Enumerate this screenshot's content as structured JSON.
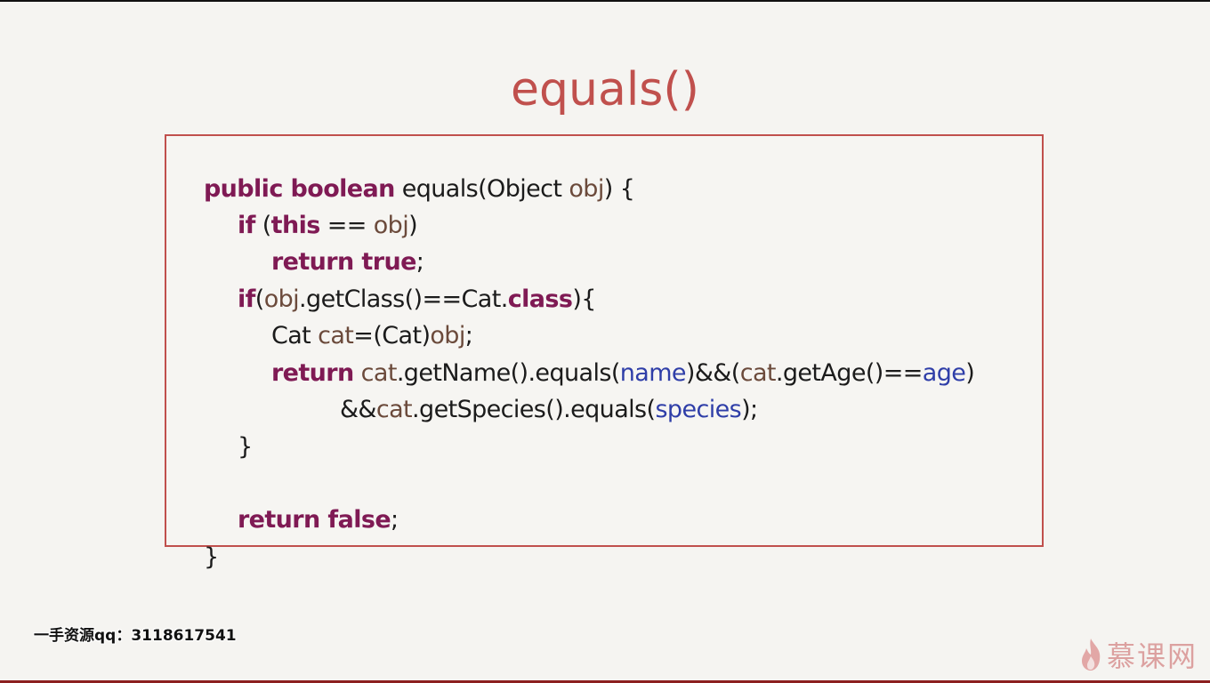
{
  "slide": {
    "title": "equals()"
  },
  "code": {
    "lines": [
      [
        {
          "t": "public boolean",
          "c": "kw"
        },
        {
          "t": " equals(Object ",
          "c": "n"
        },
        {
          "t": "obj",
          "c": "var"
        },
        {
          "t": ") {",
          "c": "n"
        }
      ],
      [
        {
          "t": "if",
          "c": "kw"
        },
        {
          "t": " (",
          "c": "n"
        },
        {
          "t": "this",
          "c": "kw"
        },
        {
          "t": " == ",
          "c": "n"
        },
        {
          "t": "obj",
          "c": "var"
        },
        {
          "t": ")",
          "c": "n"
        }
      ],
      [
        {
          "t": "return true",
          "c": "kw"
        },
        {
          "t": ";",
          "c": "n"
        }
      ],
      [
        {
          "t": "if",
          "c": "kw"
        },
        {
          "t": "(",
          "c": "n"
        },
        {
          "t": "obj",
          "c": "var"
        },
        {
          "t": ".getClass()==Cat.",
          "c": "n"
        },
        {
          "t": "class",
          "c": "kw"
        },
        {
          "t": "){",
          "c": "n"
        }
      ],
      [
        {
          "t": "Cat ",
          "c": "n"
        },
        {
          "t": "cat",
          "c": "var"
        },
        {
          "t": "=(Cat)",
          "c": "n"
        },
        {
          "t": "obj",
          "c": "var"
        },
        {
          "t": ";",
          "c": "n"
        }
      ],
      [
        {
          "t": "return",
          "c": "kw"
        },
        {
          "t": " ",
          "c": "n"
        },
        {
          "t": "cat",
          "c": "var"
        },
        {
          "t": ".getName().equals(",
          "c": "n"
        },
        {
          "t": "name",
          "c": "fld"
        },
        {
          "t": ")&&(",
          "c": "n"
        },
        {
          "t": "cat",
          "c": "var"
        },
        {
          "t": ".getAge()==",
          "c": "n"
        },
        {
          "t": "age",
          "c": "fld"
        },
        {
          "t": ")",
          "c": "n"
        }
      ],
      [
        {
          "t": "&&",
          "c": "n"
        },
        {
          "t": "cat",
          "c": "var"
        },
        {
          "t": ".getSpecies().equals(",
          "c": "n"
        },
        {
          "t": "species",
          "c": "fld"
        },
        {
          "t": ");",
          "c": "n"
        }
      ],
      [
        {
          "t": "}",
          "c": "n"
        }
      ],
      [
        {
          "t": "return false",
          "c": "kw"
        },
        {
          "t": ";",
          "c": "n"
        }
      ],
      [
        {
          "t": "}",
          "c": "n"
        }
      ]
    ]
  },
  "watermark": {
    "text": "一手资源qq：3118617541"
  },
  "logo": {
    "text": "慕课网",
    "icon": "flame-icon"
  },
  "colors": {
    "title": "#c0504d",
    "keyword": "#7f1a54",
    "variable": "#6b4a3b",
    "field": "#2f3ea8",
    "border": "#c0504d"
  }
}
